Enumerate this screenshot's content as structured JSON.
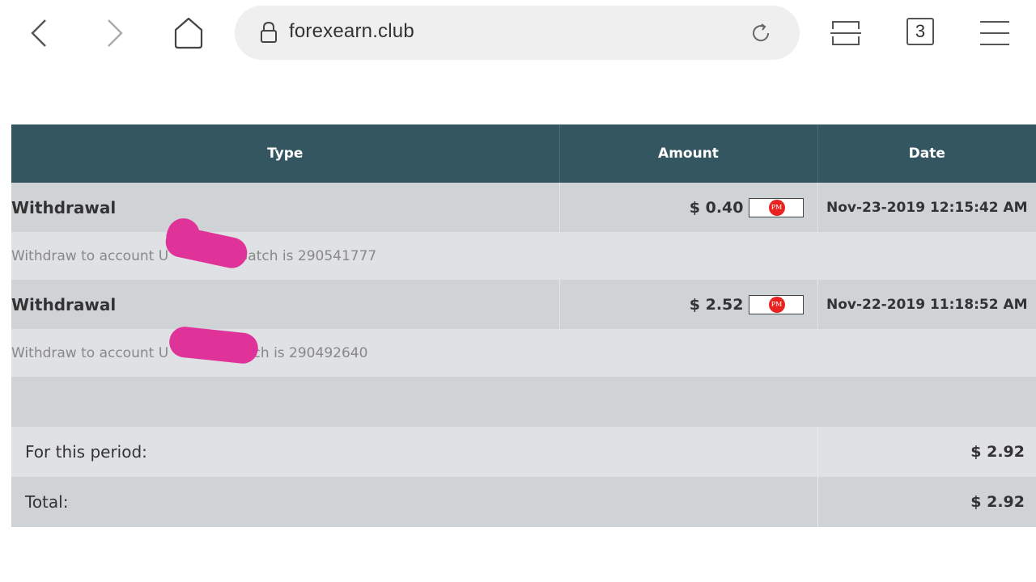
{
  "browser": {
    "url": "forexearn.club",
    "tab_count": "3"
  },
  "table": {
    "headers": {
      "type": "Type",
      "amount": "Amount",
      "date": "Date"
    },
    "rows": [
      {
        "type": "Withdrawal",
        "amount": "$ 0.40",
        "payment_method_icon": "pm-perfect-money-icon",
        "payment_method_label": "PM",
        "date": "Nov-23-2019 12:15:42 AM",
        "detail": "Withdraw to account U          41. Batch is 290541777"
      },
      {
        "type": "Withdrawal",
        "amount": "$ 2.52",
        "payment_method_icon": "pm-perfect-money-icon",
        "payment_method_label": "PM",
        "date": "Nov-22-2019 11:18:52 AM",
        "detail": "Withdraw to account U            . Batch is 290492640"
      }
    ],
    "summary": {
      "period_label": "For this period:",
      "period_value": "$ 2.92",
      "total_label": "Total:",
      "total_value": "$ 2.92"
    }
  },
  "colors": {
    "header_bg": "#335660",
    "row_dark": "#d0d3d6",
    "row_light": "#dfe1e4",
    "pm_red": "#e8231f",
    "redaction": "#e0339a"
  }
}
